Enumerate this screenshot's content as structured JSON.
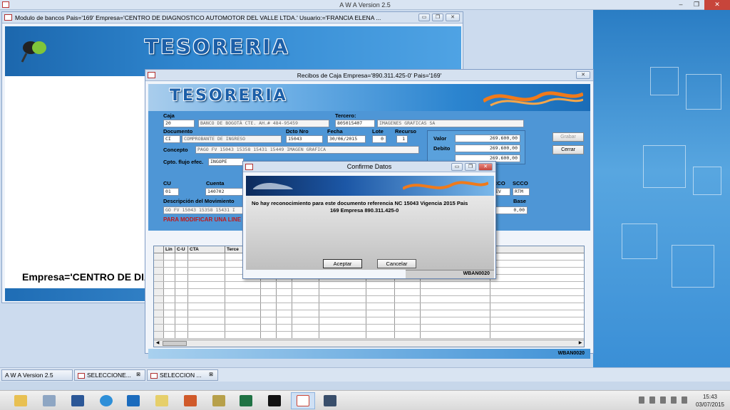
{
  "app": {
    "title": "A W A Version 2.5"
  },
  "bg_window": {
    "title": "Modulo de bancos  Pais='169'  Empresa='CENTRO DE DIAGNOSTICO AUTOMOTOR DEL VALLE LTDA.'  Usuario:='FRANCIA ELENA ...",
    "logo": "TESORERIA",
    "empresa": "Empresa='CENTRO DE DIAG"
  },
  "main_window": {
    "title": "Recibos de Caja   Empresa='890.311.425-0'  Pais='169'",
    "logo": "TESORERIA",
    "labels": {
      "caja": "Caja",
      "tercero": "Tercero:",
      "documento": "Documento",
      "dcto_nro": "Dcto Nro",
      "fecha": "Fecha",
      "lote": "Lote",
      "recurso": "Recurso",
      "concepto": "Concepto",
      "cpto_flujo": "Cpto. flujo efec.",
      "valor": "Valor",
      "debito": "Debito",
      "cu": "CU",
      "cuenta": "Cuenta",
      "cco": "CCO",
      "scco": "SCCO",
      "descripcion": "Descripción del Movimiento",
      "base": "Base"
    },
    "fields": {
      "caja_code": "20",
      "caja_name": "BANCO DE BOGOTÁ CTE. AH.# 484-95459",
      "tercero_id": "805015407",
      "tercero_name": "IMAGENES GRAFICAS SA",
      "doc_code": "CI",
      "doc_name": "COMPROBANTE DE INGRESO",
      "dcto_nro": "15043",
      "fecha": "30/06/2015",
      "lote": "0",
      "recurso": "1",
      "concepto": "PAGO FV 15043 15358 15431 15449 IMAGEN GRAFICA",
      "cpto_flujo": "INGOPE",
      "valor": "269.600,00",
      "debito": "269.600,00",
      "third": "269.600,00",
      "cu": "01",
      "cuenta": "140702",
      "cco": "EV",
      "scco": "RTM",
      "descripcion": "GO FV 15043 15358 15431 I",
      "base": "0,00"
    },
    "note": "PARA MODIFICAR UNA LINE",
    "buttons": {
      "grabar": "Grabar",
      "cerrar": "Cerrar"
    },
    "grid_headers": [
      "Lin",
      "C-U",
      "CTA",
      "Terce"
    ],
    "footer_code": "WBAN0020"
  },
  "dialog": {
    "title": "Confirme Datos",
    "message_line1": "No hay reconocimiento para este documento referencia NC 15043          Vigencia 2015  Pais",
    "message_line2": "169  Empresa 890.311.425-0",
    "accept": "Aceptar",
    "cancel": "Cancelar",
    "footer_code": "WBAN0020"
  },
  "mdi_tabs": [
    {
      "label": "A W A Version 2.5"
    },
    {
      "label": "SELECCIONE..."
    },
    {
      "label": "SELECCION ..."
    }
  ],
  "taskbar": {
    "time": "15:43",
    "date": "03/07/2015"
  },
  "colors": {
    "accent_blue": "#2f86cf",
    "note_red": "#c21818"
  }
}
